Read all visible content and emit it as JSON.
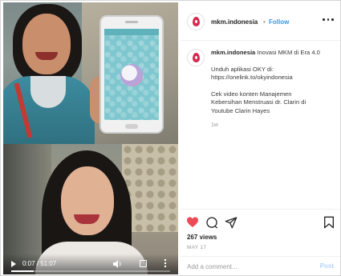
{
  "post": {
    "username": "mkm.indonesia",
    "separator": "•",
    "follow_label": "Follow",
    "caption": {
      "username": "mkm.indonesia",
      "title": "Inovasi MKM di Era 4.0",
      "line1a": "Unduh aplikasi OKY di:",
      "line1b": "https://onelink.to/okyindonesia",
      "line2a": "Cek video konten Manajemen",
      "line2b": "Kebersihan Menstruasi dr. Clarin di",
      "line2c": "Youtube Clarin Hayes",
      "age": "1w"
    },
    "views": "267 views",
    "date": "MAY 17",
    "comment_placeholder": "Add a comment...",
    "post_label": "Post"
  },
  "video": {
    "time": "0:07 / 51:07",
    "progress_fraction": 0.14
  },
  "icons": {
    "heart": "heart-icon",
    "comment": "comment-icon",
    "share": "share-icon",
    "save": "bookmark-icon",
    "more": "more-icon"
  },
  "colors": {
    "heart": "#ed4956",
    "follow": "#3897f0",
    "brand": "#d6294e"
  }
}
